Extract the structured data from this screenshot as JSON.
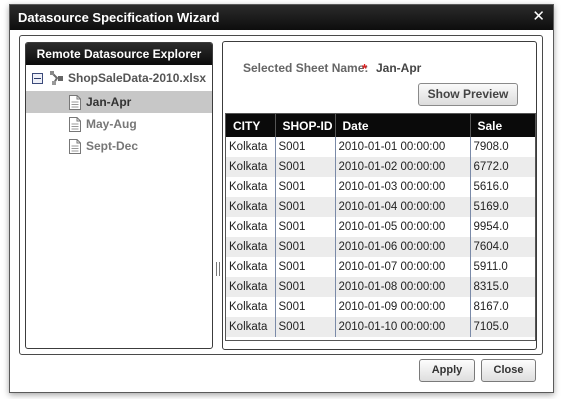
{
  "dialog": {
    "title": "Datasource Specification Wizard",
    "close_glyph": "✕"
  },
  "explorer": {
    "header": "Remote Datasource Explorer",
    "root": {
      "label": "ShopSaleData-2010.xlsx",
      "expanded": true,
      "icon": "datasource-icon"
    },
    "items": [
      {
        "label": "Jan-Apr",
        "selected": true,
        "icon": "document-icon"
      },
      {
        "label": "May-Aug",
        "selected": false,
        "icon": "document-icon"
      },
      {
        "label": "Sept-Dec",
        "selected": false,
        "icon": "document-icon"
      }
    ]
  },
  "preview": {
    "sheet_label": "Selected Sheet Name:",
    "required_mark": "*",
    "sheet_value": "Jan-Apr",
    "show_preview_label": "Show Preview",
    "columns": [
      "CITY",
      "SHOP-ID",
      "Date",
      "Sale"
    ],
    "rows": [
      [
        "Kolkata",
        "S001",
        "2010-01-01 00:00:00",
        "7908.0"
      ],
      [
        "Kolkata",
        "S001",
        "2010-01-02 00:00:00",
        "6772.0"
      ],
      [
        "Kolkata",
        "S001",
        "2010-01-03 00:00:00",
        "5616.0"
      ],
      [
        "Kolkata",
        "S001",
        "2010-01-04 00:00:00",
        "5169.0"
      ],
      [
        "Kolkata",
        "S001",
        "2010-01-05 00:00:00",
        "9954.0"
      ],
      [
        "Kolkata",
        "S001",
        "2010-01-06 00:00:00",
        "7604.0"
      ],
      [
        "Kolkata",
        "S001",
        "2010-01-07 00:00:00",
        "5911.0"
      ],
      [
        "Kolkata",
        "S001",
        "2010-01-08 00:00:00",
        "8315.0"
      ],
      [
        "Kolkata",
        "S001",
        "2010-01-09 00:00:00",
        "8167.0"
      ],
      [
        "Kolkata",
        "S001",
        "2010-01-10 00:00:00",
        "7105.0"
      ]
    ]
  },
  "footer": {
    "apply_label": "Apply",
    "close_label": "Close"
  },
  "colors": {
    "header_bg": "#0a0a0a",
    "selected_row": "#c7c7c7",
    "required": "#dd2222"
  }
}
